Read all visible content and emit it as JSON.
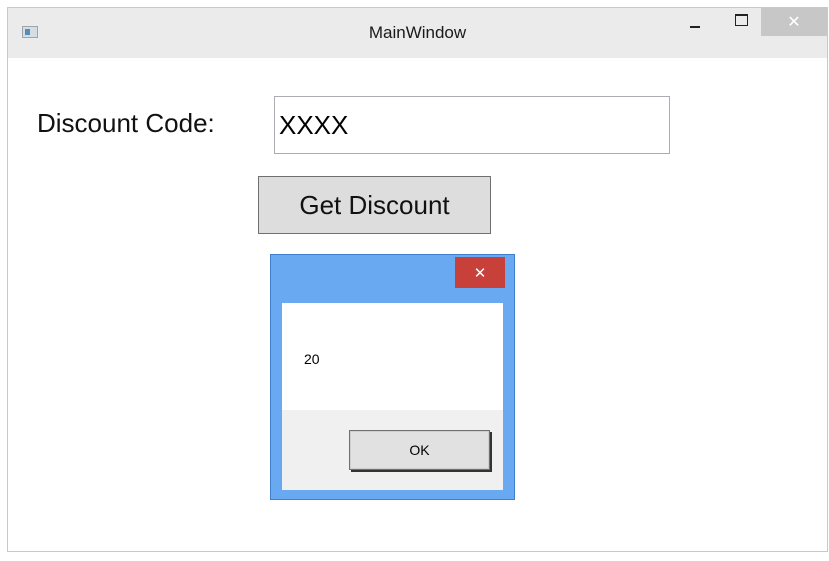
{
  "window": {
    "title": "MainWindow",
    "controls": {
      "minimize_icon": "minimize-icon",
      "maximize_icon": "maximize-icon",
      "close_icon": "close-icon",
      "close_glyph": "✕"
    }
  },
  "form": {
    "discount_label": "Discount Code:",
    "discount_value": "XXXX",
    "get_discount_label": "Get Discount"
  },
  "message_box": {
    "message": "20",
    "ok_label": "OK",
    "close_glyph": "✕",
    "title_color": "#68a9f2",
    "close_color": "#c7403a"
  }
}
